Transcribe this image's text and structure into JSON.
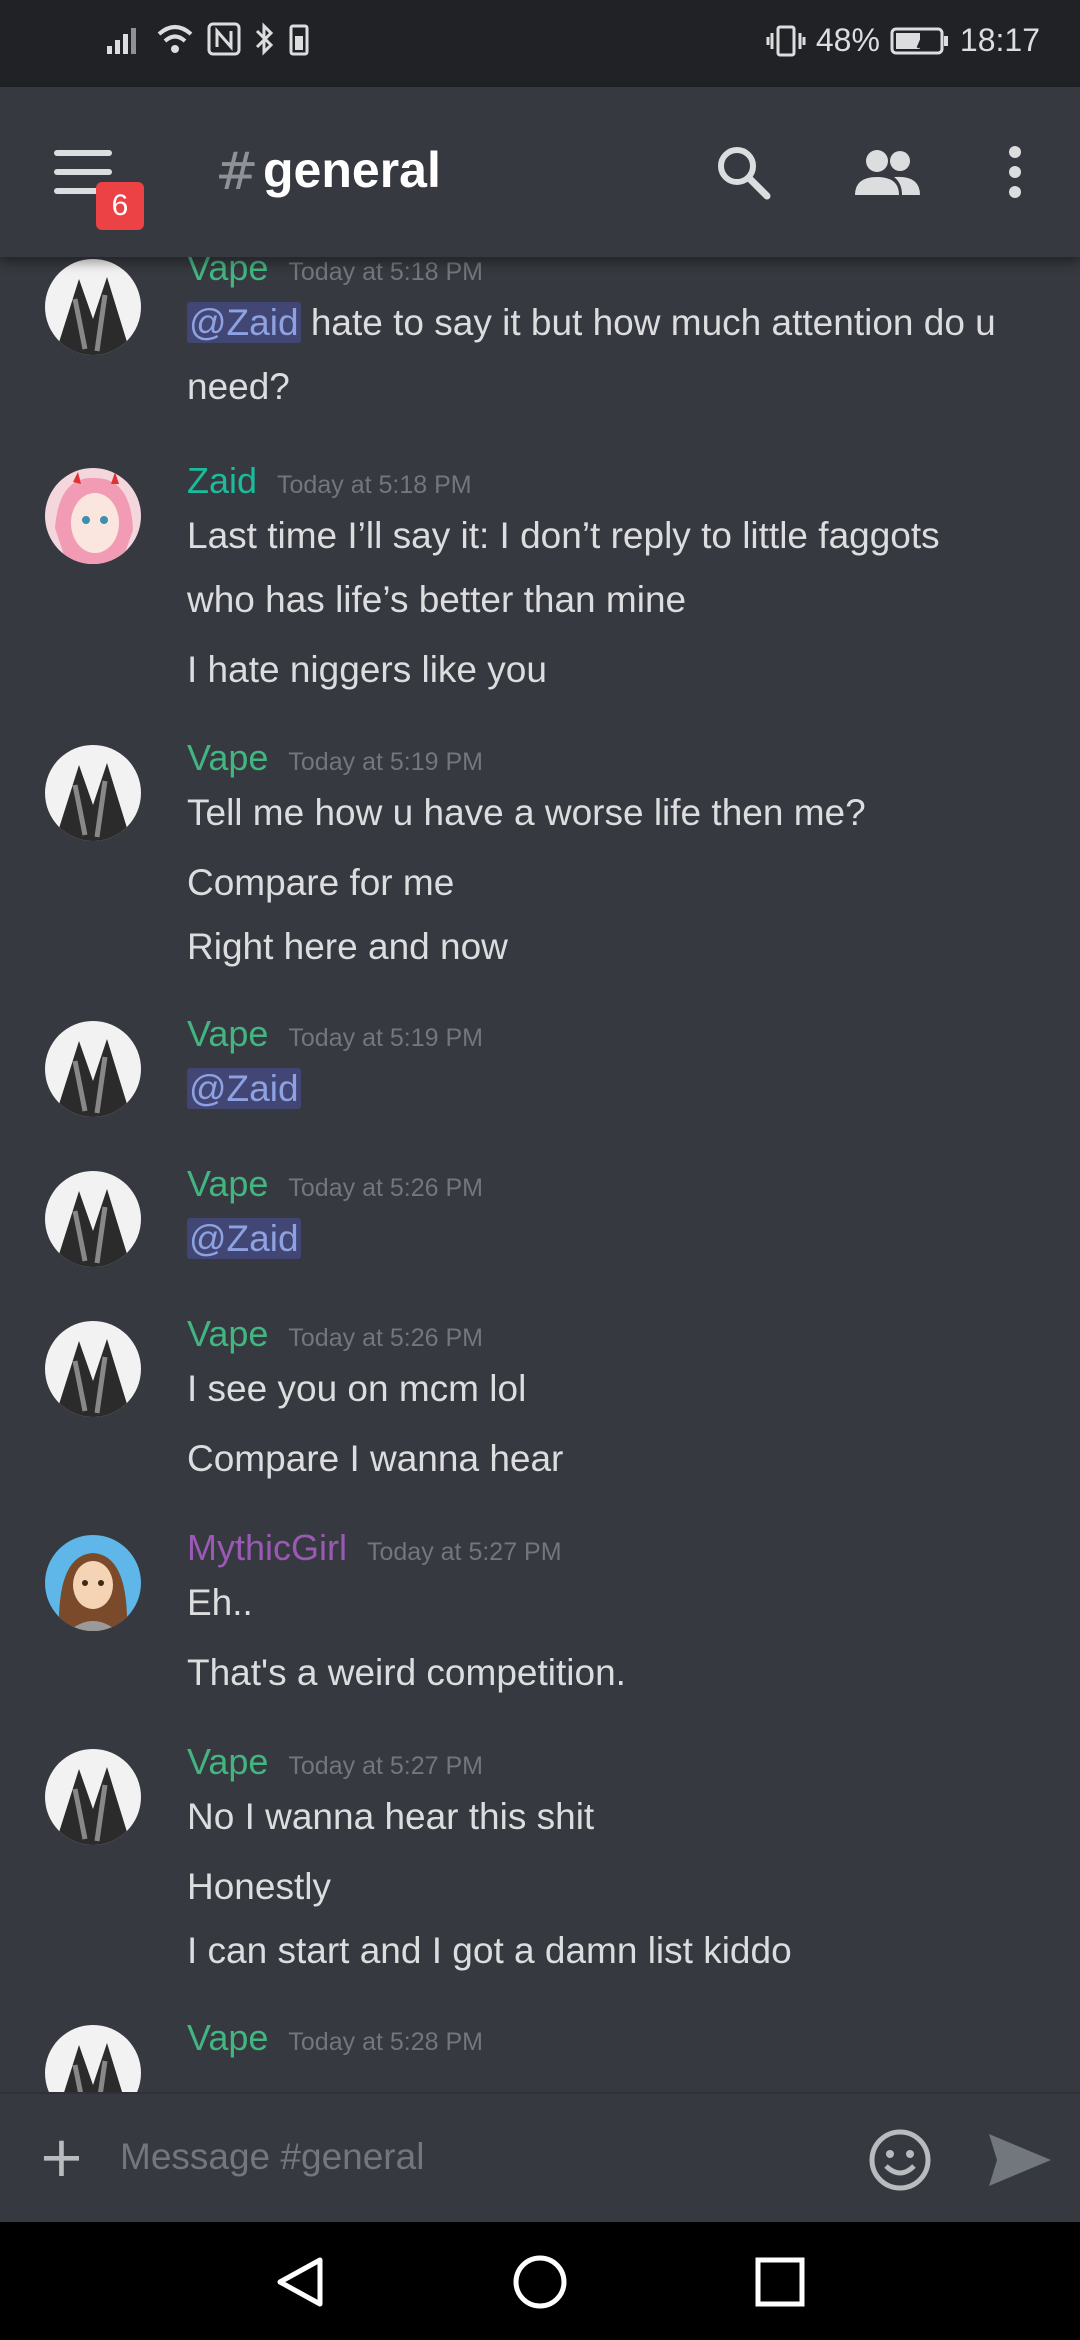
{
  "status_bar": {
    "battery": "48%",
    "time": "18:17"
  },
  "header": {
    "menu_badge": "6",
    "channel_hash": "#",
    "channel_name": "general"
  },
  "messages": [
    {
      "author": "Vape",
      "author_color": "#43b581",
      "timestamp": "Today at 5:18 PM",
      "lines": [
        "@Zaid hate to say it but how much attention do u",
        "need?"
      ]
    },
    {
      "author": "Zaid",
      "author_color": "#1abc9c",
      "timestamp": "Today at 5:18 PM",
      "lines": [
        "Last time I’ll say it: I don’t reply to little faggots",
        "who has life’s better than mine",
        "I hate niggers like you"
      ]
    },
    {
      "author": "Vape",
      "author_color": "#43b581",
      "timestamp": "Today at 5:19 PM",
      "lines": [
        "Tell me how u have a worse life then me?",
        "Compare for me",
        "Right here and now"
      ]
    },
    {
      "author": "Vape",
      "author_color": "#43b581",
      "timestamp": "Today at 5:19 PM",
      "lines": [
        "@Zaid"
      ]
    },
    {
      "author": "Vape",
      "author_color": "#43b581",
      "timestamp": "Today at 5:26 PM",
      "lines": [
        "@Zaid"
      ]
    },
    {
      "author": "Vape",
      "author_color": "#43b581",
      "timestamp": "Today at 5:26 PM",
      "lines": [
        "I see you on mcm lol",
        "Compare I wanna hear"
      ]
    },
    {
      "author": "MythicGirl",
      "author_color": "#9b59b6",
      "timestamp": "Today at 5:27 PM",
      "lines": [
        "Eh..",
        "That's a weird competition."
      ]
    },
    {
      "author": "Vape",
      "author_color": "#43b581",
      "timestamp": "Today at 5:27 PM",
      "lines": [
        "No I wanna hear this shit",
        "Honestly",
        "I can start and I got a damn list kiddo"
      ]
    },
    {
      "author": "Vape",
      "author_color": "#43b581",
      "timestamp": "Today at 5:28 PM",
      "lines": []
    }
  ],
  "composer": {
    "placeholder": "Message #general"
  },
  "colors": {
    "mention_text": "#8ea1e1",
    "mention_bg": "#414675"
  }
}
